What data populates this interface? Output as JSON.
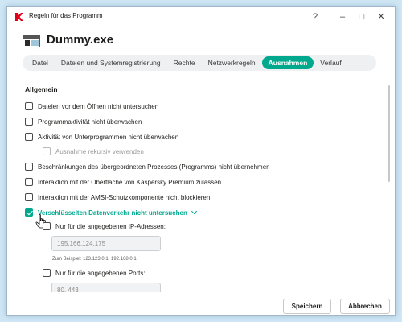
{
  "window": {
    "title": "Regeln für das Programm",
    "controls": {
      "help": "?",
      "minimize": "–",
      "maximize": "□",
      "close": "✕"
    }
  },
  "header": {
    "app_name": "Dummy.exe"
  },
  "tabs": [
    {
      "label": "Datei",
      "active": false
    },
    {
      "label": "Dateien und Systemregistrierung",
      "active": false
    },
    {
      "label": "Rechte",
      "active": false
    },
    {
      "label": "Netzwerkregeln",
      "active": false
    },
    {
      "label": "Ausnahmen",
      "active": true
    },
    {
      "label": "Verlauf",
      "active": false
    }
  ],
  "section": {
    "title": "Allgemein"
  },
  "options": [
    {
      "label": "Dateien vor dem Öffnen nicht untersuchen",
      "checked": false
    },
    {
      "label": "Programmaktivität nicht überwachen",
      "checked": false
    },
    {
      "label": "Aktivität von Unterprogrammen nicht überwachen",
      "checked": false
    },
    {
      "label": "Ausnahme rekursiv verwenden",
      "checked": false,
      "disabled": true
    },
    {
      "label": "Beschränkungen des übergeordneten Prozesses (Programms) nicht übernehmen",
      "checked": false
    },
    {
      "label": "Interaktion mit der Oberfläche von Kaspersky Premium zulassen",
      "checked": false
    },
    {
      "label": "Interaktion mit der AMSI-Schutzkomponente nicht blockieren",
      "checked": false
    },
    {
      "label": "Verschlüsselten Datenverkehr nicht untersuchen",
      "checked": true
    }
  ],
  "sub_options": {
    "ip": {
      "label": "Nur für die angegebenen IP-Adressen:",
      "checked": false,
      "placeholder": "195.166.124.175"
    },
    "hint": "Zum Beispiel: 123.123.0.1, 192.168.0.1",
    "ports": {
      "label": "Nur für die angegebenen Ports:",
      "checked": false,
      "placeholder": "80, 443"
    }
  },
  "buttons": {
    "save": "Speichern",
    "cancel": "Abbrechen"
  },
  "colors": {
    "accent": "#00a88e",
    "brand_red": "#e2001a"
  }
}
